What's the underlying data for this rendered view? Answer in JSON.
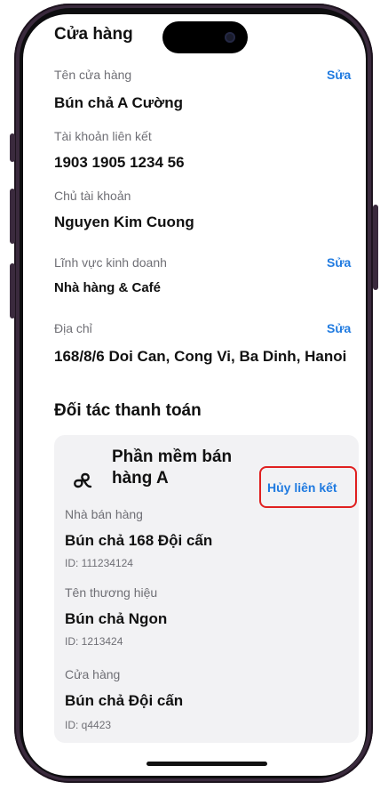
{
  "store_section": {
    "title": "Cửa hàng",
    "store_name_label": "Tên cửa hàng",
    "store_name_edit": "Sửa",
    "store_name_value": "Bún chả A Cường",
    "linked_account_label": "Tài khoản liên kết",
    "linked_account_value": "1903 1905 1234 56",
    "account_holder_label": "Chủ tài khoản",
    "account_holder_value": "Nguyen Kim Cuong",
    "business_field_label": "Lĩnh vực kinh doanh",
    "business_field_edit": "Sửa",
    "business_field_value": "Nhà hàng & Café",
    "address_label": "Địa chỉ",
    "address_edit": "Sửa",
    "address_value": "168/8/6 Doi Can, Cong Vi, Ba Dinh, Hanoi"
  },
  "partner_section": {
    "title": "Đối tác thanh toán",
    "partner_name_line1": "Phần mềm bán",
    "partner_name_line2": "hàng A",
    "unlink_label": "Hủy liên kết",
    "seller_label": "Nhà bán hàng",
    "seller_value": "Bún chả 168 Đội cấn",
    "seller_id": "ID: 111234124",
    "brand_label": "Tên thương hiệu",
    "brand_value": "Bún chả Ngon",
    "brand_id": "ID: 1213424",
    "store_label": "Cửa hàng",
    "store_value": "Bún chả Đội cấn",
    "store_id": "ID: q4423"
  },
  "colors": {
    "accent": "#1f7ae0",
    "highlight_border": "#e02020",
    "card_bg": "#f2f2f4",
    "frame": "#3a2a3d"
  },
  "icons": {
    "partner_logo": "loop-knot-logo-icon"
  }
}
